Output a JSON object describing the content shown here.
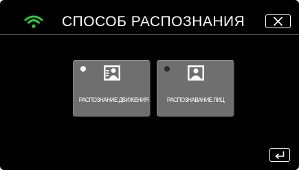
{
  "header": {
    "title": "СПОСОБ РАСПОЗНАНИЯ",
    "wifi_icon": "wifi-icon",
    "wifi_color": "#2ecc3c",
    "close_icon": "close-icon"
  },
  "options": [
    {
      "label": "РАСПОЗНАНИЕ ДВИЖЕНИЯ",
      "icon": "motion-detect-icon",
      "selected": true
    },
    {
      "label": "РАСПОЗНАВАНИЕ ЛИЦ",
      "icon": "face-detect-icon",
      "selected": false
    }
  ],
  "footer": {
    "back_icon": "back-return-icon"
  }
}
